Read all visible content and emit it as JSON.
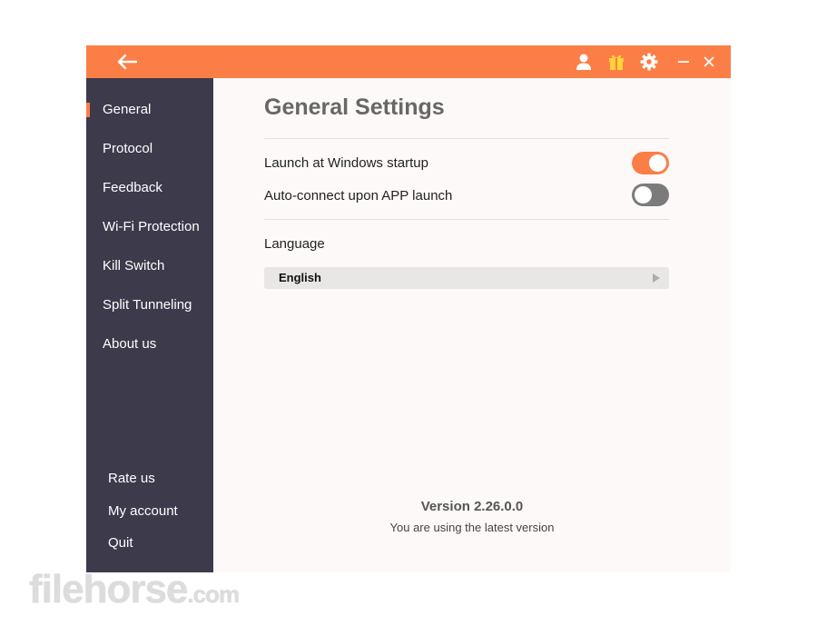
{
  "titlebar": {
    "icons": [
      "back-arrow-icon",
      "user-icon",
      "gift-icon",
      "gear-icon",
      "minimize-icon",
      "close-icon"
    ],
    "accent_color": "#fc7e47"
  },
  "sidebar": {
    "background_color": "#3d3a4b",
    "items": [
      {
        "label": "General",
        "active": true
      },
      {
        "label": "Protocol",
        "active": false
      },
      {
        "label": "Feedback",
        "active": false
      },
      {
        "label": "Wi-Fi Protection",
        "active": false
      },
      {
        "label": "Kill Switch",
        "active": false
      },
      {
        "label": "Split Tunneling",
        "active": false
      },
      {
        "label": "About us",
        "active": false
      }
    ],
    "bottom_items": [
      {
        "label": "Rate us"
      },
      {
        "label": "My account"
      },
      {
        "label": "Quit"
      }
    ]
  },
  "main": {
    "title": "General Settings",
    "settings": [
      {
        "label": "Launch at Windows startup",
        "enabled": true
      },
      {
        "label": "Auto-connect upon APP launch",
        "enabled": false
      }
    ],
    "language": {
      "label": "Language",
      "selected": "English"
    },
    "version": {
      "text": "Version 2.26.0.0",
      "status": "You are using the latest version"
    }
  },
  "watermark": {
    "text": "filehorse",
    "suffix": ".com"
  }
}
